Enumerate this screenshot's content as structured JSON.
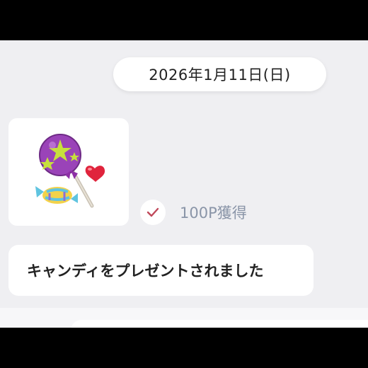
{
  "chat": {
    "date_label": "2026年1月11日(日)",
    "points_text": "100P獲得",
    "message_text": "キャンディをプレゼントされました"
  },
  "icons": {
    "sticker": "candy-sticker-icon",
    "check": "check-icon"
  },
  "colors": {
    "background": "#efeff2",
    "check": "#c0485a",
    "points_text": "#8a95a8"
  }
}
